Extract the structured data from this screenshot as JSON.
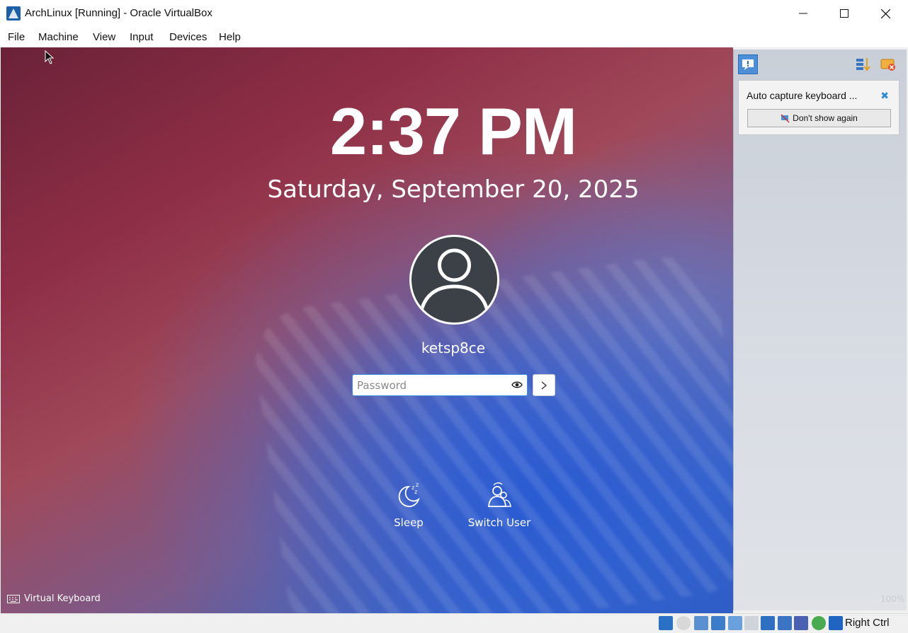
{
  "window": {
    "title": "ArchLinux [Running] - Oracle VirtualBox",
    "minimize": "—",
    "maximize": "☐",
    "close": "✕"
  },
  "menu": [
    "File",
    "Machine",
    "View",
    "Input",
    "Devices",
    "Help"
  ],
  "lockscreen": {
    "time": "2:37 PM",
    "date": "Saturday, September 20, 2025",
    "username": "ketsp8ce",
    "password_placeholder": "Password",
    "actions": [
      {
        "label": "Sleep",
        "icon": "sleep-icon"
      },
      {
        "label": "Switch User",
        "icon": "switch-user-icon"
      }
    ],
    "virtual_keyboard": "Virtual Keyboard"
  },
  "notification_panel": {
    "title": "Auto capture keyboard ...",
    "dont_show_again": "Don't show again",
    "zoom": "100%"
  },
  "statusbar": {
    "host_key": "Right Ctrl"
  },
  "colors": {
    "accent": "#3d8ee0",
    "close_x": "#2c8cd6"
  }
}
